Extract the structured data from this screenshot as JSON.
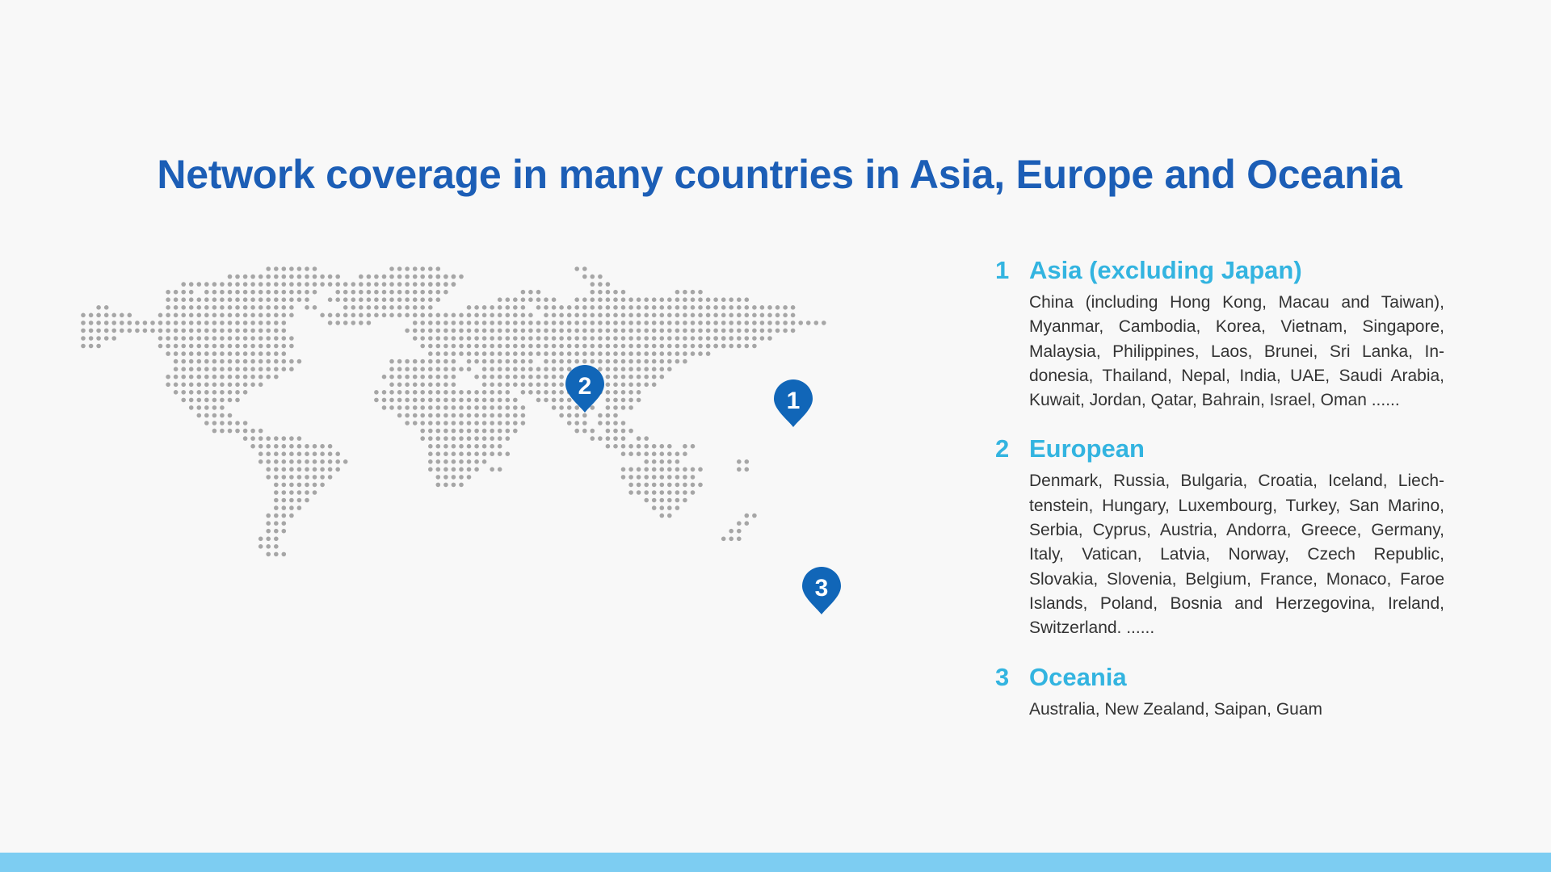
{
  "page": {
    "title": "Network coverage in many countries in Asia, Europe and Oceania"
  },
  "regions": [
    {
      "number": "1",
      "name": "Asia (excluding Japan)",
      "countries": "China (including Hong Kong, Macau and Taiwan), Myanmar, Cambodia, Korea, Vietnam, Singapore, Malaysia, Philippines, Laos, Brunei, Sri Lanka, In­donesia, Thailand, Nepal, India, UAE, Saudi Arabia, Kuwait, Jordan, Qatar, Bahrain, Israel, Oman ......"
    },
    {
      "number": "2",
      "name": "European",
      "countries": "Denmark, Russia, Bulgaria, Croatia, Iceland, Liech­tenstein, Hungary, Luxembourg, Turkey, San Marino, Serbia, Cyprus, Austria, Andorra, Greece, Germany, Italy, Vatican, Latvia, Norway, Czech Re­public, Slovakia, Slovenia, Belgium, France, Monaco, Faroe Islands, Poland, Bosnia and Herze­govina, Ireland, Switzerland. ......"
    },
    {
      "number": "3",
      "name": "Oceania",
      "countries": "Australia, New Zealand, Saipan, Guam"
    }
  ],
  "map": {
    "dot_color": "#a6a6a6",
    "pin_color": "#1166b8",
    "pins": [
      {
        "label": "1",
        "region": "Asia (excluding Japan)"
      },
      {
        "label": "2",
        "region": "European"
      },
      {
        "label": "3",
        "region": "Oceania"
      }
    ]
  },
  "colors": {
    "title": "#1c5eb6",
    "region_heading": "#33b4e0",
    "body_text": "#333333",
    "bottom_bar": "#7dcdf2",
    "background": "#f8f8f8"
  }
}
